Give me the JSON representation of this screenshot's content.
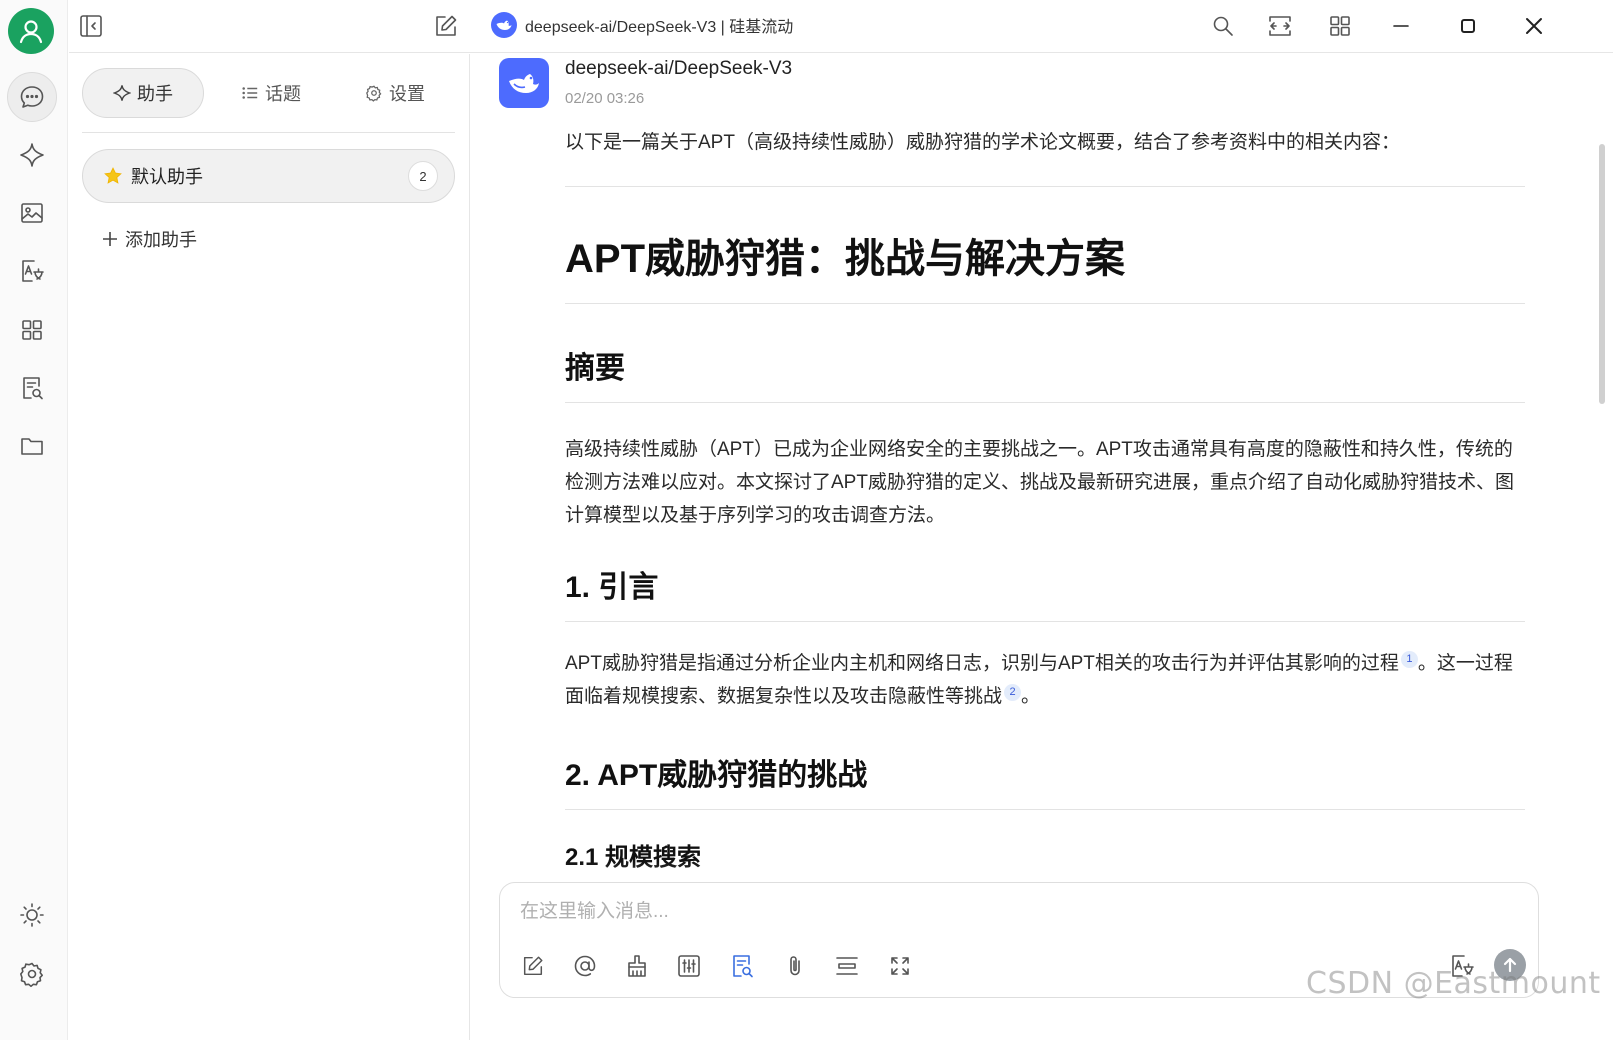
{
  "topbar": {
    "model_label": "deepseek-ai/DeepSeek-V3 | 硅基流动"
  },
  "sidebar": {
    "tabs": [
      {
        "label": "助手",
        "icon": "sparkle-icon"
      },
      {
        "label": "话题",
        "icon": "list-icon"
      },
      {
        "label": "设置",
        "icon": "gear-icon"
      }
    ],
    "assistant": {
      "name": "默认助手",
      "count": "2"
    },
    "add_label": "添加助手"
  },
  "message": {
    "sender": "deepseek-ai/DeepSeek-V3",
    "time": "02/20 03:26",
    "intro": "以下是一篇关于APT（高级持续性威胁）威胁狩猎的学术论文概要，结合了参考资料中的相关内容：",
    "title": "APT威胁狩猎：挑战与解决方案",
    "abstract_heading": "摘要",
    "abstract_text": "高级持续性威胁（APT）已成为企业网络安全的主要挑战之一。APT攻击通常具有高度的隐蔽性和持久性，传统的检测方法难以应对。本文探讨了APT威胁狩猎的定义、挑战及最新研究进展，重点介绍了自动化威胁狩猎技术、图计算模型以及基于序列学习的攻击调查方法。",
    "section1_heading": "1. 引言",
    "section1_part1": "APT威胁狩猎是指通过分析企业内主机和网络日志，识别与APT相关的攻击行为并评估其影响的过程",
    "section1_ref1": "1",
    "section1_part2": "。这一过程面临着规模搜索、数据复杂性以及攻击隐蔽性等挑战",
    "section1_ref2": "2",
    "section1_part3": "。",
    "section2_heading": "2. APT威胁狩猎的挑战",
    "section21_heading": "2.1 规模搜索"
  },
  "input": {
    "placeholder": "在这里输入消息..."
  },
  "watermark": "CSDN @Eastmount",
  "colors": {
    "avatar_green": "#1aa260",
    "deepseek_blue": "#4d6bfe",
    "active_tool_blue": "#3a6fe0"
  }
}
